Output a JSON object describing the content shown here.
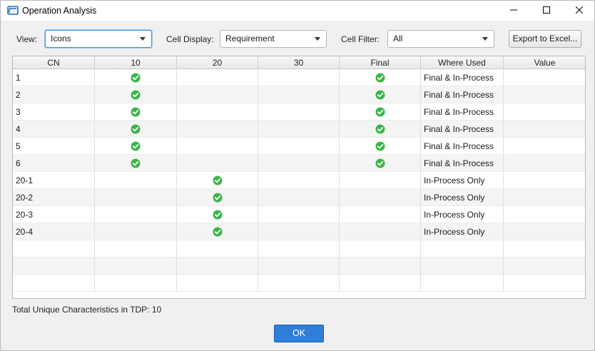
{
  "window": {
    "title": "Operation Analysis",
    "icon": "app-window-icon",
    "controls": [
      "minimize-icon",
      "maximize-icon",
      "close-icon"
    ]
  },
  "toolbar": {
    "view_label": "View:",
    "view_value": "Icons",
    "cell_display_label": "Cell Display:",
    "cell_display_value": "Requirement",
    "cell_filter_label": "Cell Filter:",
    "cell_filter_value": "All",
    "export_label": "Export to Excel..."
  },
  "table": {
    "columns": [
      "CN",
      "10",
      "20",
      "30",
      "Final",
      "Where Used",
      "Value"
    ],
    "check_icon": "check-circle-icon",
    "check_color": "#3cb54a",
    "rows": [
      {
        "cn": "1",
        "op10": true,
        "op20": false,
        "op30": false,
        "final": true,
        "where_used": "Final & In-Process",
        "value": ""
      },
      {
        "cn": "2",
        "op10": true,
        "op20": false,
        "op30": false,
        "final": true,
        "where_used": "Final & In-Process",
        "value": ""
      },
      {
        "cn": "3",
        "op10": true,
        "op20": false,
        "op30": false,
        "final": true,
        "where_used": "Final & In-Process",
        "value": ""
      },
      {
        "cn": "4",
        "op10": true,
        "op20": false,
        "op30": false,
        "final": true,
        "where_used": "Final & In-Process",
        "value": ""
      },
      {
        "cn": "5",
        "op10": true,
        "op20": false,
        "op30": false,
        "final": true,
        "where_used": "Final & In-Process",
        "value": ""
      },
      {
        "cn": "6",
        "op10": true,
        "op20": false,
        "op30": false,
        "final": true,
        "where_used": "Final & In-Process",
        "value": ""
      },
      {
        "cn": "20-1",
        "op10": false,
        "op20": true,
        "op30": false,
        "final": false,
        "where_used": "In-Process Only",
        "value": ""
      },
      {
        "cn": "20-2",
        "op10": false,
        "op20": true,
        "op30": false,
        "final": false,
        "where_used": "In-Process Only",
        "value": ""
      },
      {
        "cn": "20-3",
        "op10": false,
        "op20": true,
        "op30": false,
        "final": false,
        "where_used": "In-Process Only",
        "value": ""
      },
      {
        "cn": "20-4",
        "op10": false,
        "op20": true,
        "op30": false,
        "final": false,
        "where_used": "In-Process Only",
        "value": ""
      }
    ],
    "empty_rows": 3
  },
  "footer": {
    "total_label": "Total Unique Characteristics in TDP:",
    "total_value": "10",
    "ok_label": "OK"
  },
  "colors": {
    "accent": "#2f7ed8",
    "focus_border": "#3d8fe0"
  }
}
